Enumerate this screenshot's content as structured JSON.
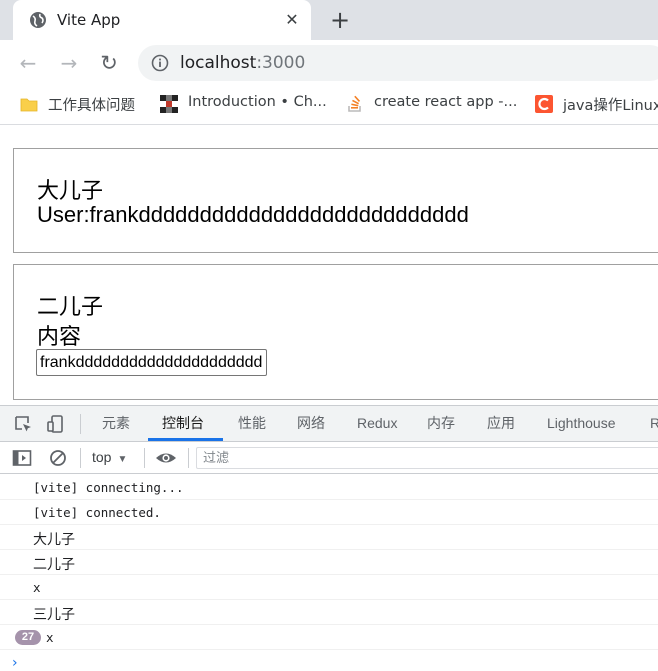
{
  "browser": {
    "tab": {
      "title": "Vite App",
      "close": "✕",
      "favicon": "globe-icon"
    },
    "new_tab": "+",
    "toolbar": {
      "back": "←",
      "forward": "→",
      "reload": "↻"
    },
    "address": {
      "host": "localhost",
      "port": ":3000"
    },
    "bookmarks": [
      {
        "label": "工作具体问题",
        "icon": "folder-icon"
      },
      {
        "label": "Introduction • Ch...",
        "icon": "checker-icon"
      },
      {
        "label": "create react app -...",
        "icon": "stack-icon"
      },
      {
        "label": "java操作Linux",
        "icon": "c-logo-icon"
      }
    ]
  },
  "page": {
    "son1": {
      "title": "大儿子",
      "user_line": "User:frankddddddddddddddddddddddddddd"
    },
    "son2": {
      "title": "二儿子",
      "content_label": "内容",
      "input_value": "frankddddddddddddddddddddd"
    }
  },
  "devtools": {
    "tabs": [
      "元素",
      "控制台",
      "性能",
      "网络",
      "Redux",
      "内存",
      "应用",
      "Lighthouse",
      "R"
    ],
    "active_tab": "控制台",
    "context": "top",
    "context_caret": "▼",
    "filter_placeholder": "过滤",
    "logs": [
      {
        "text": "[vite] connecting..."
      },
      {
        "text": "[vite] connected."
      },
      {
        "text": "大儿子"
      },
      {
        "text": "二儿子"
      },
      {
        "text": "x"
      },
      {
        "text": "三儿子"
      },
      {
        "text": "x",
        "repeat": "27"
      }
    ],
    "prompt": "›"
  },
  "colors": {
    "accent": "#1a73e8",
    "badge": "#a593ab",
    "tabstrip": "#dee1e6"
  }
}
